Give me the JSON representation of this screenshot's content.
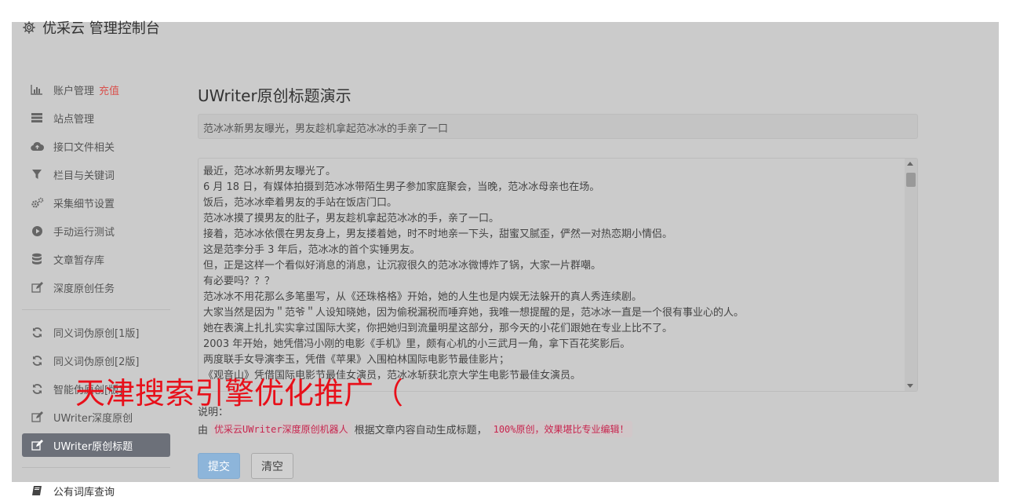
{
  "header": {
    "title": "优采云 管理控制台",
    "icon": "gear-icon"
  },
  "sidebar": {
    "items": [
      {
        "label": "账户管理",
        "extra": "充值",
        "icon": "bar-chart-icon"
      },
      {
        "label": "站点管理",
        "icon": "server-icon"
      },
      {
        "label": "接口文件相关",
        "icon": "cloud-upload-icon"
      },
      {
        "label": "栏目与关键词",
        "icon": "filter-icon"
      },
      {
        "label": "采集细节设置",
        "icon": "gears-icon"
      },
      {
        "label": "手动运行测试",
        "icon": "play-circle-icon"
      },
      {
        "label": "文章暂存库",
        "icon": "database-icon"
      },
      {
        "label": "深度原创任务",
        "icon": "edit-icon"
      },
      {
        "label": "同义词伪原创[1版]",
        "icon": "refresh-icon"
      },
      {
        "label": "同义词伪原创[2版]",
        "icon": "refresh-icon"
      },
      {
        "label": "智能伪原创[版]",
        "icon": "refresh-icon"
      },
      {
        "label": "UWriter深度原创",
        "icon": "edit-icon"
      },
      {
        "label": "UWriter原创标题",
        "icon": "edit-icon",
        "active": true
      }
    ],
    "footer_item": {
      "label": "公有词库查询",
      "icon": "book-icon"
    }
  },
  "main": {
    "title": "UWriter原创标题演示",
    "title_input_value": "范冰冰新男友曝光，男友趁机拿起范冰冰的手亲了一口",
    "article_lines": [
      "最近，范冰冰新男友曝光了。",
      "6 月 18 日，有媒体拍摄到范冰冰带陌生男子参加家庭聚会，当晚，范冰冰母亲也在场。",
      "饭后，范冰冰牵着男友的手站在饭店门口。",
      "范冰冰摸了摸男友的肚子，男友趁机拿起范冰冰的手，亲了一口。",
      "接着，范冰冰依偎在男友身上，男友搂着她，时不时地亲一下头，甜蜜又腻歪，俨然一对热恋期小情侣。",
      "这是范李分手 3 年后，范冰冰的首个实锤男友。",
      "但，正是这样一个看似好消息的消息，让沉寂很久的范冰冰微博炸了锅，大家一片群嘲。",
      "有必要吗？？？",
      "范冰冰不用花那么多笔墨写，从《还珠格格》开始，她的人生也是内娱无法躲开的真人秀连续剧。",
      "大家当然是因为＂范爷＂人设知晓她，因为偷税漏税而唾弃她，我唯一想提醒的是，范冰冰一直是一个很有事业心的人。",
      "她在表演上扎扎实实拿过国际大奖，你把她归到流量明星这部分，那今天的小花们跟她在专业上比不了。",
      "2003 年开始，她凭借冯小刚的电影《手机》里，颇有心机的小三武月一角，拿下百花奖影后。",
      "两度联手女导演李玉，凭借《苹果》入围柏林国际电影节最佳影片；",
      "《观音山》凭借国际电影节最佳女演员，范冰冰斩获北京大学生电影节最佳女演员。"
    ],
    "desc_label": "说明：",
    "desc_prefix": "由",
    "desc_code1": "优采云UWriter深度原创机器人",
    "desc_middle": "根据文章内容自动生成标题，",
    "desc_code2": "100%原创，效果堪比专业编辑！",
    "submit_label": "提交",
    "clear_label": "清空"
  },
  "overlay": {
    "text": "天津搜索引擎优化推广（"
  },
  "colors": {
    "accent": "#8db5da",
    "active_nav": "#6c7079",
    "alert": "#d9534f",
    "overlay": "#e8101a",
    "code": "#c7254e"
  }
}
